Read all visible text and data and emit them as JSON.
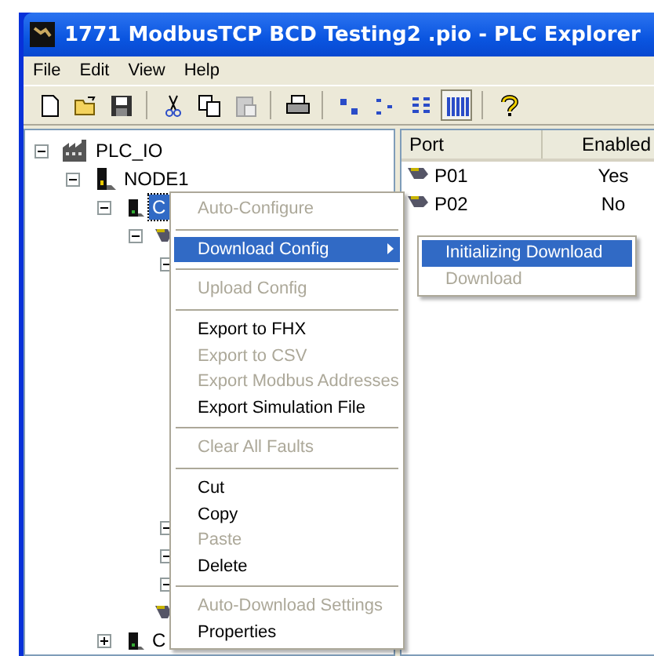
{
  "window": {
    "title": "1771 ModbusTCP BCD Testing2 .pio - PLC Explorer"
  },
  "menu_bar": [
    "File",
    "Edit",
    "View",
    "Help"
  ],
  "toolbar": [
    {
      "kind": "new"
    },
    {
      "kind": "open"
    },
    {
      "kind": "save"
    },
    {
      "kind": "sep"
    },
    {
      "kind": "cut"
    },
    {
      "kind": "copy"
    },
    {
      "kind": "paste",
      "disabled": true
    },
    {
      "kind": "sep"
    },
    {
      "kind": "print"
    },
    {
      "kind": "sep"
    },
    {
      "kind": "large"
    },
    {
      "kind": "small"
    },
    {
      "kind": "list"
    },
    {
      "kind": "details",
      "pressed": true
    },
    {
      "kind": "sep"
    },
    {
      "kind": "help"
    }
  ],
  "tree": [
    {
      "label": "PLC_IO",
      "kind": "plc",
      "expanded": true,
      "selected": false,
      "children": [
        {
          "label": "NODE1",
          "kind": "node",
          "expanded": true,
          "selected": false,
          "children": [
            {
              "label": "C",
              "kind": "cpu",
              "expanded": true,
              "selected": true,
              "children": [
                {
                  "kind": "port",
                  "expanded": true,
                  "children": [
                    {
                      "expanded": true
                    },
                    {
                      "expanded": true
                    },
                    {
                      "expanded": true
                    },
                    {
                      "expanded": true
                    }
                  ]
                },
                {
                  "kind": "port"
                }
              ]
            },
            {
              "label": "C",
              "kind": "cpu",
              "expanded": false,
              "selected": false
            }
          ]
        }
      ]
    }
  ],
  "list": {
    "columns": [
      "Port",
      "Enabled"
    ],
    "rows": [
      {
        "port": "P01",
        "enabled": "Yes"
      },
      {
        "port": "P02",
        "enabled": "No"
      }
    ]
  },
  "context_menu": [
    {
      "kind": "item",
      "label": "Auto-Configure",
      "disabled": true,
      "selected": false
    },
    {
      "kind": "separator"
    },
    {
      "kind": "item",
      "label": "Download Config",
      "disabled": false,
      "selected": true,
      "submenu": true
    },
    {
      "kind": "separator"
    },
    {
      "kind": "item",
      "label": "Upload Config",
      "disabled": true,
      "selected": false
    },
    {
      "kind": "separator"
    },
    {
      "kind": "item",
      "label": "Export to FHX",
      "disabled": false,
      "selected": false
    },
    {
      "kind": "item",
      "label": "Export to CSV",
      "disabled": true,
      "selected": false
    },
    {
      "kind": "item",
      "label": "Export Modbus Addresses",
      "disabled": true,
      "selected": false
    },
    {
      "kind": "item",
      "label": "Export Simulation File",
      "disabled": false,
      "selected": false
    },
    {
      "kind": "separator"
    },
    {
      "kind": "item",
      "label": "Clear All Faults",
      "disabled": true,
      "selected": false
    },
    {
      "kind": "separator"
    },
    {
      "kind": "item",
      "label": "Cut",
      "disabled": false,
      "selected": false
    },
    {
      "kind": "item",
      "label": "Copy",
      "disabled": false,
      "selected": false
    },
    {
      "kind": "item",
      "label": "Paste",
      "disabled": true,
      "selected": false
    },
    {
      "kind": "item",
      "label": "Delete",
      "disabled": false,
      "selected": false
    },
    {
      "kind": "separator"
    },
    {
      "kind": "item",
      "label": "Auto-Download Settings",
      "disabled": true,
      "selected": false
    },
    {
      "kind": "item",
      "label": "Properties",
      "disabled": false,
      "selected": false
    }
  ],
  "submenu": [
    {
      "kind": "item",
      "label": "Initializing Download",
      "disabled": false,
      "selected": true
    },
    {
      "kind": "item",
      "label": "Download",
      "disabled": true,
      "selected": false
    }
  ]
}
